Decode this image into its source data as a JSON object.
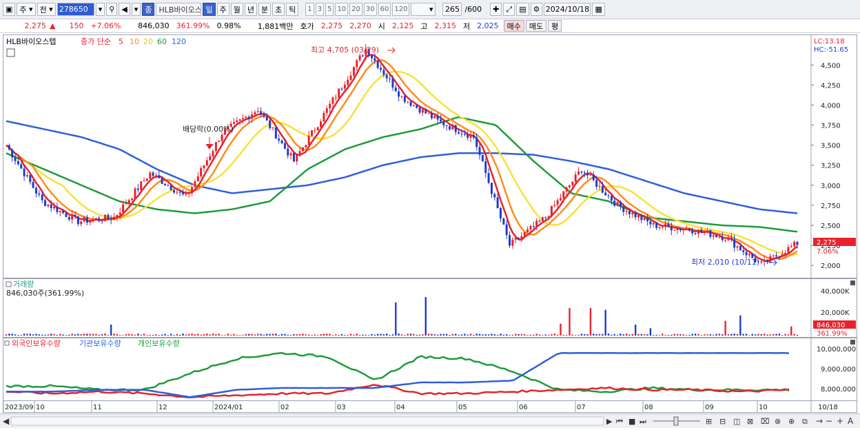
{
  "toolbar": {
    "market": "주",
    "prev": "전",
    "code": "278650",
    "stock_name_badge": "종",
    "stock_name": "HLB바이오스",
    "periods": [
      "일",
      "주",
      "월",
      "년",
      "분",
      "초",
      "틱"
    ],
    "selected_period": "일",
    "intervals": [
      "1",
      "3",
      "5",
      "10",
      "20",
      "30",
      "60",
      "120"
    ],
    "count": "265",
    "count_total": "/600",
    "date": "2024/10/18"
  },
  "info": {
    "price": "2,275",
    "change_sign": "▲",
    "change": "150",
    "change_pct": "+7.06%",
    "volume": "846,030",
    "volume_pct": "361.99%",
    "turnover_pct": "0.98%",
    "amount": "1,881백만",
    "quote_label": "호가",
    "ask": "2,275",
    "bid": "2,270",
    "open_label": "시",
    "open": "2,125",
    "high_label": "고",
    "high": "2,315",
    "low_label": "저",
    "low": "2,025",
    "buy_label": "매수",
    "sell_label": "매도",
    "eval_label": "평"
  },
  "price_panel": {
    "stock_label": "HLB바이오스텝",
    "ma_label": "종가 단순",
    "ma_periods": [
      "5",
      "10",
      "20",
      "60",
      "120"
    ],
    "lc": "LC:13.18",
    "hc": "HC:-51.65",
    "high_annotation": "최고 4,705 (03/29)",
    "low_annotation": "최저 2,010 (10/11)",
    "dividend_annotation": "배당락(0.00%)",
    "current_price": "2,275",
    "current_pct": "7.06%",
    "y_ticks": [
      "4,500",
      "4,250",
      "4,000",
      "3,750",
      "3,500",
      "3,250",
      "3,000",
      "2,750",
      "2,500",
      "2,250",
      "2,000"
    ]
  },
  "volume_panel": {
    "title": "거래량",
    "subtitle": "846,030주(361.99%)",
    "y_ticks": [
      "40,000K",
      "20,000K"
    ],
    "current": "846,030",
    "current_pct": "361.99%"
  },
  "holding_panel": {
    "series": [
      "외국인보유수량",
      "기관보유수량",
      "개인보유수량"
    ],
    "y_ticks": [
      "10,000,000",
      "9,000,000",
      "8,000,000"
    ]
  },
  "x_axis": [
    "2023/09",
    "10",
    "11",
    "12",
    "2024/01",
    "02",
    "03",
    "04",
    "05",
    "06",
    "07",
    "08",
    "09",
    "10",
    "10/18"
  ],
  "colors": {
    "ma5": "#e8222c",
    "ma10": "#ff8c1a",
    "ma20": "#f5e23a",
    "ma60": "#1f9a3a",
    "ma120": "#2f5fd8",
    "up": "#e8222c",
    "down": "#1e3ccf"
  },
  "chart_data": {
    "type": "candlestick",
    "price_series_approx": [
      [
        "2023/09",
        3500
      ],
      [
        "10",
        2800
      ],
      [
        "11",
        2550
      ],
      [
        "12",
        2600
      ],
      [
        "2024/01",
        3150
      ],
      [
        "2024/01b",
        2850
      ],
      [
        "02",
        3650
      ],
      [
        "02b",
        3950
      ],
      [
        "03",
        3300
      ],
      [
        "03b",
        4000
      ],
      [
        "03/29",
        4705
      ],
      [
        "04",
        4100
      ],
      [
        "04b",
        3800
      ],
      [
        "05",
        3600
      ],
      [
        "05b",
        2250
      ],
      [
        "06",
        2600
      ],
      [
        "07",
        3200
      ],
      [
        "07b",
        2750
      ],
      [
        "08",
        2500
      ],
      [
        "09",
        2450
      ],
      [
        "10",
        2350
      ],
      [
        "10/11",
        2010
      ],
      [
        "10/18",
        2275
      ]
    ],
    "y_range": [
      1950,
      4700
    ],
    "ma120": [
      3800,
      3700,
      3600,
      3450,
      3200,
      3000,
      2900,
      2950,
      3000,
      3100,
      3250,
      3350,
      3400,
      3400,
      3380,
      3300,
      3200,
      3050,
      2900,
      2800,
      2700,
      2650
    ],
    "ma60": [
      3400,
      3200,
      3000,
      2800,
      2700,
      2650,
      2700,
      2800,
      3200,
      3450,
      3600,
      3700,
      3850,
      3750,
      3300,
      2900,
      2800,
      2600,
      2550,
      2500,
      2480,
      2420
    ],
    "foreign_holding": [
      7.9,
      7.8,
      7.9,
      7.8,
      7.6,
      7.7,
      7.8,
      7.8,
      8.3,
      7.8,
      7.8,
      7.9,
      8.0,
      8.1,
      8.0,
      8.0,
      7.9,
      8.0
    ],
    "institution_holding": [
      7.9,
      7.9,
      8.0,
      8.0,
      7.6,
      8.0,
      8.1,
      8.1,
      8.1,
      8.4,
      8.4,
      8.5,
      10.0,
      10.0,
      10.0,
      10.0,
      10.0,
      10.0
    ],
    "individual_holding": [
      8.2,
      8.2,
      8.0,
      8.0,
      8.9,
      9.7,
      10.0,
      9.8,
      8.5,
      9.8,
      9.7,
      9.0,
      8.0,
      7.9,
      8.1,
      8.0,
      8.0,
      8.0
    ]
  }
}
